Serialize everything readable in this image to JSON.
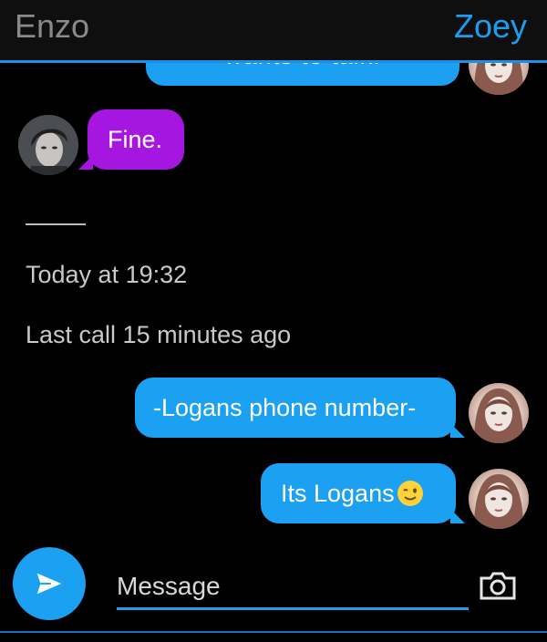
{
  "header": {
    "contact_left": "Enzo",
    "contact_right": "Zoey",
    "accent": "#1e9df0"
  },
  "messages": [
    {
      "sender": "Zoey",
      "text": "wants to talk.",
      "color": "#1ba0f2"
    },
    {
      "sender": "Enzo",
      "text": "Fine.",
      "color": "#a516e0"
    },
    {
      "sender": "Zoey",
      "text": "-Logans phone number-",
      "color": "#1ba0f2"
    },
    {
      "sender": "Zoey",
      "text": "Its Logans",
      "emoji": "winking-face-icon",
      "color": "#1ba0f2"
    }
  ],
  "info": {
    "date_text": "Today at 19:32",
    "last_call_text": "Last call 15 minutes ago"
  },
  "composer": {
    "placeholder": "Message",
    "send_icon": "send-icon",
    "camera_icon": "camera-icon"
  }
}
